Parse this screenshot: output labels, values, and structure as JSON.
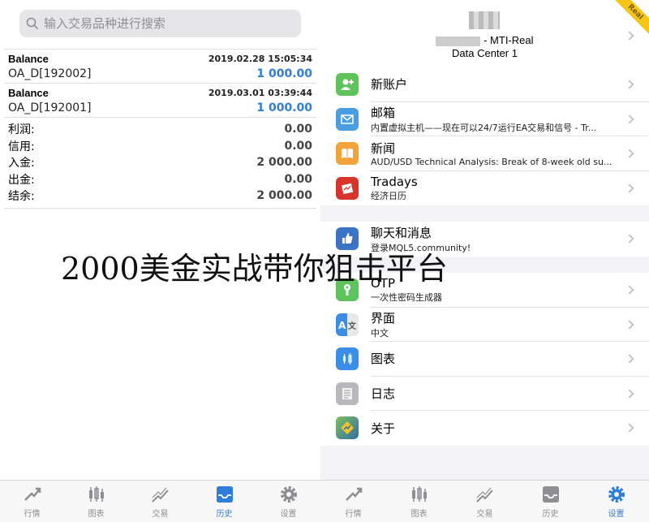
{
  "search": {
    "placeholder": "输入交易品种进行搜索"
  },
  "history": {
    "deals": [
      {
        "type": "Balance",
        "time": "2019.02.28 15:05:34",
        "account": "OA_D[192002]",
        "amount": "1 000.00"
      },
      {
        "type": "Balance",
        "time": "2019.03.01 03:39:44",
        "account": "OA_D[192001]",
        "amount": "1 000.00"
      }
    ],
    "summary": [
      {
        "label": "利润:",
        "value": "0.00"
      },
      {
        "label": "信用:",
        "value": "0.00"
      },
      {
        "label": "入金:",
        "value": "2 000.00"
      },
      {
        "label": "出金:",
        "value": "0.00"
      },
      {
        "label": "结余:",
        "value": "2 000.00"
      }
    ]
  },
  "overlay_text": "2000美金实战带你狙击平台",
  "tabs": [
    "行情",
    "图表",
    "交易",
    "历史",
    "设置"
  ],
  "settings": {
    "account_suffix": "- MTI-Real",
    "server": "Data Center 1",
    "badge": "Real",
    "items": [
      {
        "title": "新账户",
        "subtitle": ""
      },
      {
        "title": "邮箱",
        "subtitle": "内置虚拟主机——现在可以24/7运行EA交易和信号 - Tr..."
      },
      {
        "title": "新闻",
        "subtitle": "AUD/USD Technical Analysis: Break of 8-week old su..."
      },
      {
        "title": "Tradays",
        "subtitle": "经济日历"
      },
      {
        "title": "聊天和消息",
        "subtitle": "登录MQL5.community!"
      },
      {
        "title": "OTP",
        "subtitle": "一次性密码生成器"
      },
      {
        "title": "界面",
        "subtitle": "中文"
      },
      {
        "title": "图表",
        "subtitle": ""
      },
      {
        "title": "日志",
        "subtitle": ""
      },
      {
        "title": "关于",
        "subtitle": ""
      }
    ]
  },
  "colors": {
    "accent": "#2f7ddb",
    "green": "#5cc45b",
    "blue": "#4a9ee0",
    "orange": "#f2a33a",
    "red": "#d9342b"
  }
}
